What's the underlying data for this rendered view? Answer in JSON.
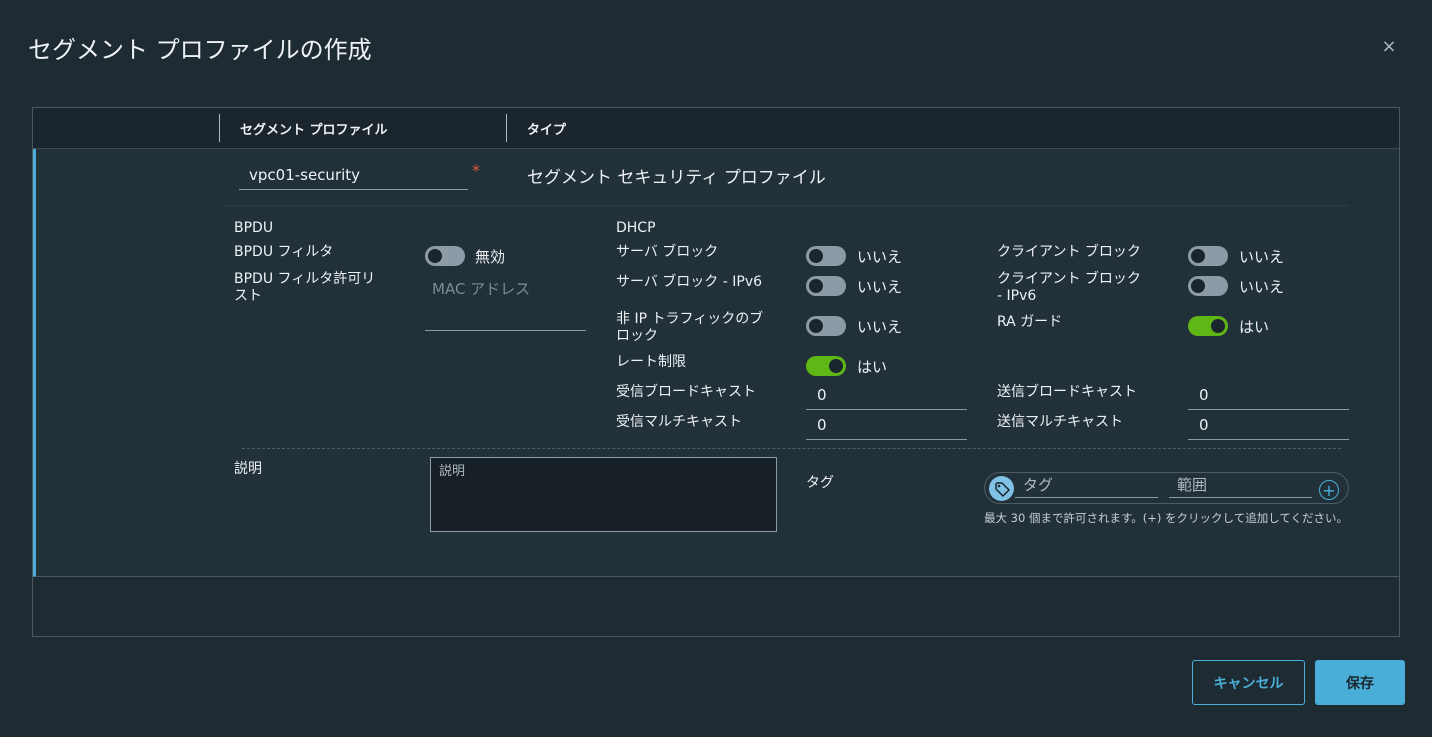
{
  "modal": {
    "title": "セグメント プロファイルの作成",
    "close_label": "×"
  },
  "grid": {
    "columns": [
      "セグメント プロファイル",
      "タイプ"
    ],
    "row": {
      "name_value": "vpc01-security",
      "required_marker": "*",
      "type": "セグメント セキュリティ プロファイル"
    }
  },
  "bpdu": {
    "section_label": "BPDU",
    "filter_label": "BPDU フィルタ",
    "filter_state": false,
    "filter_text": "無効",
    "allow_list_label": "BPDU フィルタ許可リ\nスト",
    "mac_placeholder": "MAC アドレス"
  },
  "dhcp": {
    "section_label": "DHCP",
    "server_block_label": "サーバ ブロック",
    "server_block_state": false,
    "server_block_text": "いいえ",
    "server_block_v6_label": "サーバ ブロック - IPv6",
    "server_block_v6_state": false,
    "server_block_v6_text": "いいえ",
    "client_block_label": "クライアント ブロック",
    "client_block_state": false,
    "client_block_text": "いいえ",
    "client_block_v6_label": "クライアント ブロック\n- IPv6",
    "client_block_v6_state": false,
    "client_block_v6_text": "いいえ",
    "non_ip_block_label": "非 IP トラフィックのブ\nロック",
    "non_ip_block_state": false,
    "non_ip_block_text": "いいえ",
    "ra_guard_label": "RA ガード",
    "ra_guard_state": true,
    "ra_guard_text": "はい",
    "rate_limit_label": "レート制限",
    "rate_limit_state": true,
    "rate_limit_text": "はい",
    "rx_broadcast_label": "受信ブロードキャスト",
    "rx_broadcast_value": "0",
    "tx_broadcast_label": "送信ブロードキャスト",
    "tx_broadcast_value": "0",
    "rx_multicast_label": "受信マルチキャスト",
    "rx_multicast_value": "0",
    "tx_multicast_label": "送信マルチキャスト",
    "tx_multicast_value": "0"
  },
  "description": {
    "label": "説明",
    "placeholder": "説明"
  },
  "tags": {
    "label": "タグ",
    "tag_placeholder": "タグ",
    "scope_placeholder": "範囲",
    "add_symbol": "+",
    "helper": "最大 30 個まで許可されます。(+) をクリックして追加してください。"
  },
  "footer": {
    "cancel_label": "キャンセル",
    "save_label": "保存"
  },
  "colors": {
    "accent": "#49afd9",
    "toggle_on": "#5eb715",
    "toggle_off": "#8c9ba5",
    "required": "#e0583d"
  }
}
